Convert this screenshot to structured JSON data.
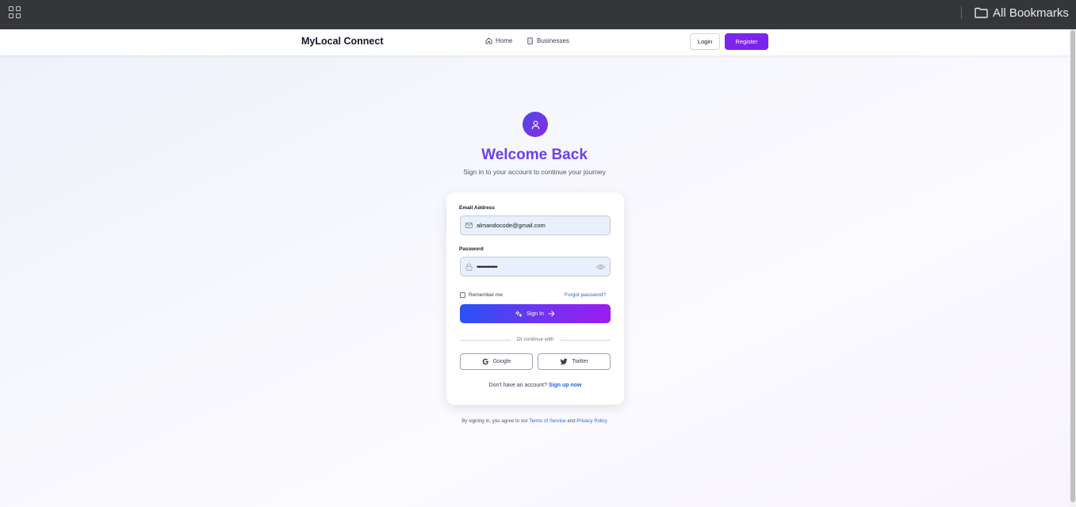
{
  "browser": {
    "bookmarks_label": "All Bookmarks"
  },
  "nav": {
    "brand": "MyLocal Connect",
    "home": "Home",
    "businesses": "Businesses",
    "login": "Login",
    "register": "Register"
  },
  "hero": {
    "title": "Welcome Back",
    "subtitle": "Sign in to your account to continue your journey"
  },
  "form": {
    "email_label": "Email Address",
    "email_value": "almandocode@gmail.com",
    "password_label": "Password",
    "password_masked": "••••••••••••",
    "remember_label": "Remember me",
    "remember_checked": false,
    "forgot_label": "Forgot password?",
    "signin_label": "Sign In",
    "divider_text": "Or continue with",
    "google_label": "Google",
    "twitter_label": "Twitter",
    "no_account_text": "Don't have an account?",
    "signup_label": "Sign up now"
  },
  "footer": {
    "terms_prefix": "By signing in, you agree to our",
    "terms_link": "Terms of Service",
    "and_text": "and",
    "privacy_link": "Privacy Policy"
  },
  "colors": {
    "brand_purple": "#7c24ee",
    "link_blue": "#2563eb",
    "title_purple": "#6d3ff0",
    "input_bg": "#e8effd"
  },
  "icons": {
    "apps": "apps-grid-icon",
    "folder": "folder-icon",
    "home": "home-icon",
    "business": "building-icon",
    "user": "user-icon",
    "mail": "mail-icon",
    "lock": "lock-icon",
    "eye": "eye-icon",
    "signin": "sparkle-icon",
    "arrow": "arrow-right-icon",
    "google": "google-icon",
    "twitter": "twitter-icon"
  }
}
